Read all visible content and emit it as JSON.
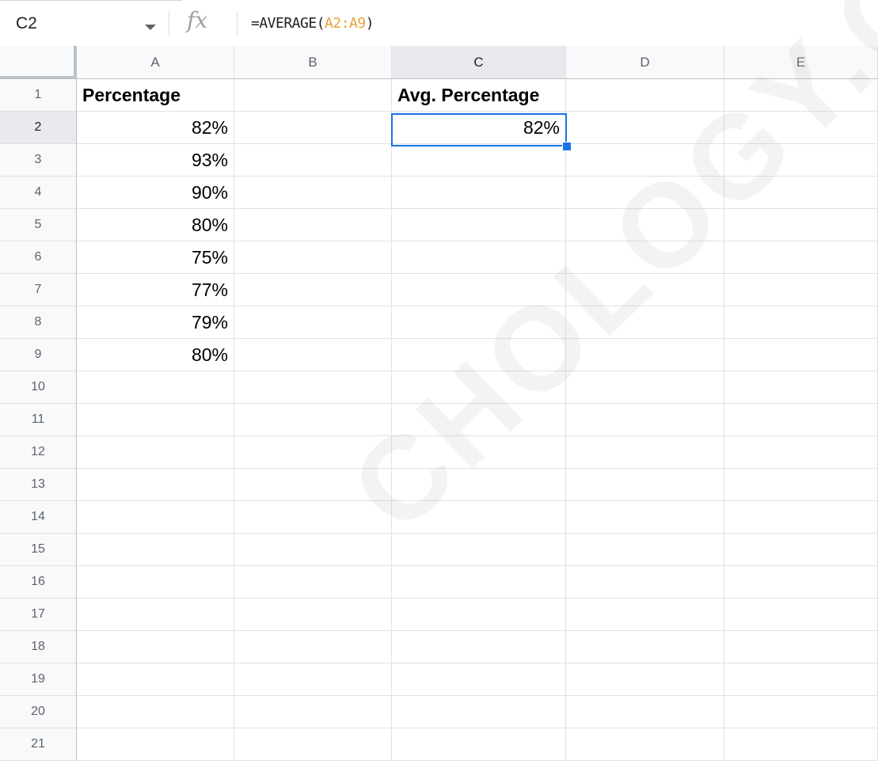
{
  "formula_bar": {
    "name_box": "C2",
    "fx_icon": "fx-icon",
    "formula_prefix": "=AVERAGE(",
    "formula_ref": "A2:A9",
    "formula_suffix": ")"
  },
  "columns": [
    "A",
    "B",
    "C",
    "D",
    "E"
  ],
  "rows": [
    "1",
    "2",
    "3",
    "4",
    "5",
    "6",
    "7",
    "8",
    "9",
    "10",
    "11",
    "12",
    "13",
    "14",
    "15",
    "16",
    "17",
    "18",
    "19",
    "20",
    "21"
  ],
  "cells": {
    "A1": "Percentage",
    "A2": "82%",
    "A3": "93%",
    "A4": "90%",
    "A5": "80%",
    "A6": "75%",
    "A7": "77%",
    "A8": "79%",
    "A9": "80%",
    "C1": "Avg. Percentage",
    "C2": "82%"
  },
  "selection": {
    "active_cell": "C2",
    "accent_color": "#1a73e8",
    "ref_color": "#e8a23a"
  },
  "watermark": "CHOLOGY.CO"
}
